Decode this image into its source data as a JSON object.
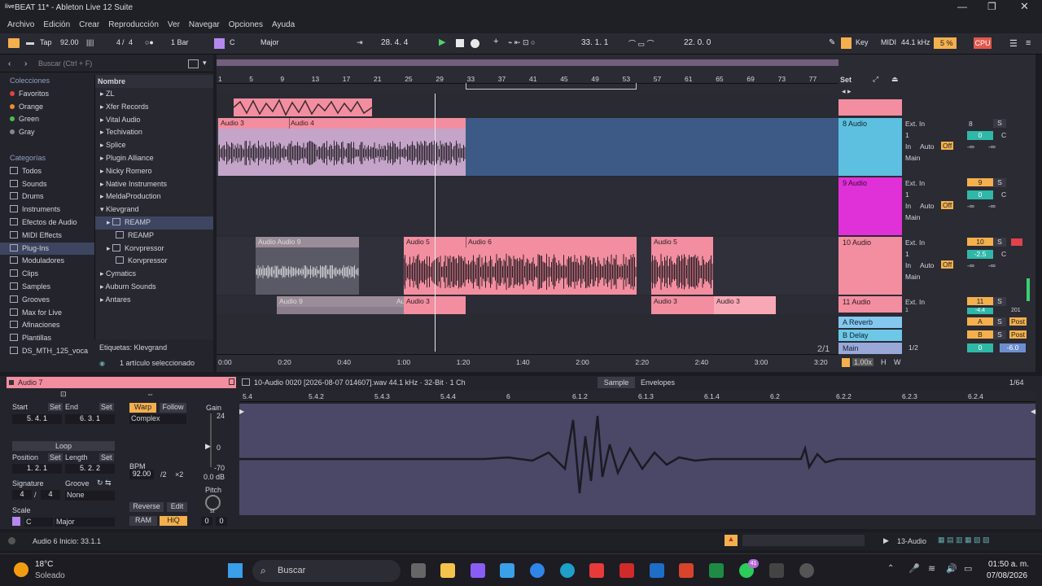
{
  "window": {
    "title": "BEAT 11* - Ableton Live 12 Suite",
    "logo": "live"
  },
  "menu": [
    "Archivo",
    "Edición",
    "Crear",
    "Reproducción",
    "Ver",
    "Navegar",
    "Opciones",
    "Ayuda"
  ],
  "transport": {
    "tap": "Tap",
    "tempo": "92.00",
    "signature_num": "4",
    "signature_den": "4",
    "quant": "1 Bar",
    "key_root": "C",
    "scale": "Major",
    "position": "28.  4.  4",
    "loop_start": "33.  1.  1",
    "loop_length": "22.  0.  0",
    "key": "Key",
    "midi": "MIDI",
    "sample_rate": "44.1 kHz",
    "cpu": "5 %",
    "cpu_label": "CPU"
  },
  "browser": {
    "search_placeholder": "Buscar (Ctrl + F)",
    "collections_title": "Colecciones",
    "collections": [
      {
        "label": "Favoritos",
        "color": "#e0443e"
      },
      {
        "label": "Orange",
        "color": "#f08a2a"
      },
      {
        "label": "Green",
        "color": "#48c048"
      },
      {
        "label": "Gray",
        "color": "#888888"
      }
    ],
    "categories_title": "Categorías",
    "categories": [
      "Todos",
      "Sounds",
      "Drums",
      "Instruments",
      "Efectos de Audio",
      "MIDI Effects",
      "Plug-Ins",
      "Moduladores",
      "Clips",
      "Samples",
      "Grooves",
      "Max for Live",
      "Afinaciones",
      "Plantillas",
      "DS_MTH_125_voca"
    ],
    "selected_category": "Plug-Ins",
    "column_title": "Nombre",
    "items": [
      "ZL",
      "Xfer Records",
      "Vital Audio",
      "Techivation",
      "Splice",
      "Plugin Alliance",
      "Nicky Romero",
      "Native Instruments",
      "MeldaProduction",
      "Klevgrand",
      "REAMP",
      "REAMP",
      "Korvpressor",
      "Korvpressor",
      "Cymatics",
      "Auburn Sounds",
      "Antares"
    ],
    "tags_label": "Etiquetas:",
    "tags_value": "Klevgrand",
    "selection_info": "1 artículo seleccionado"
  },
  "arrangement": {
    "bar_numbers": [
      "1",
      "5",
      "9",
      "13",
      "17",
      "21",
      "25",
      "29",
      "33",
      "37",
      "41",
      "45",
      "49",
      "53",
      "57",
      "61",
      "65",
      "69",
      "73",
      "77"
    ],
    "time_labels": [
      "0:00",
      "0:20",
      "0:40",
      "1:00",
      "1:20",
      "1:40",
      "2:00",
      "2:20",
      "2:40",
      "3:00",
      "3:20"
    ],
    "set_label": "Set",
    "zoom_label": "2/1",
    "clips": {
      "c1": "Audio 3",
      "c2": "Audio 4",
      "c3": "Audio Audio 9",
      "c4": "Audio 5",
      "c5": "Audio 6",
      "c6": "Audio 5",
      "c7": "Audio 9",
      "c8": "Au",
      "c9": "Audio 3",
      "c10": "Audio 3",
      "c11": "Audio 3"
    },
    "tracks": [
      {
        "name": "8 Audio",
        "input": "Ext. In",
        "channel": "1",
        "monitor": "In",
        "auto": "Auto",
        "off": "Off",
        "out": "Main",
        "num": "8",
        "vol": "0",
        "pan": "C",
        "send1": "-∞",
        "send2": "-∞"
      },
      {
        "name": "9 Audio",
        "input": "Ext. In",
        "channel": "1",
        "monitor": "In",
        "auto": "Auto",
        "off": "Off",
        "out": "Main",
        "num": "9",
        "vol": "0",
        "pan": "C",
        "send1": "-∞",
        "send2": "-∞"
      },
      {
        "name": "10 Audio",
        "input": "Ext. In",
        "channel": "1",
        "monitor": "In",
        "auto": "Auto",
        "off": "Off",
        "out": "Main",
        "num": "10",
        "vol": "-2.5",
        "pan": "C",
        "send1": "-∞",
        "send2": "-∞"
      },
      {
        "name": "11 Audio",
        "input": "Ext. In",
        "channel": "1",
        "num": "11",
        "vol": "-4.4",
        "send1": "201"
      }
    ],
    "returns": [
      {
        "name": "A Reverb",
        "letter": "A",
        "post": "Post"
      },
      {
        "name": "B Delay",
        "letter": "B",
        "post": "Post"
      }
    ],
    "main": {
      "name": "Main",
      "ratio": "1/2",
      "vol": "0",
      "db": "-6.0"
    },
    "tempo_scale": "1.00x",
    "h": "H",
    "w": "W",
    "s": "S",
    "c": "C"
  },
  "detail": {
    "clip_name": "Audio 7",
    "file_info": "10-Audio 0020 [2026-08-07 014607].wav  44.1 kHz · 32-Bit · 1 Ch",
    "tabs": [
      "Sample",
      "Envelopes"
    ],
    "grid": "1/64",
    "start_label": "Start",
    "end_label": "End",
    "set_label": "Set",
    "start": "5.   4.   1",
    "end": "6.   3.   1",
    "loop": "Loop",
    "position_label": "Position",
    "length_label": "Length",
    "position": "1.   2.   1",
    "length": "5.   2.   2",
    "signature_label": "Signature",
    "groove_label": "Groove",
    "sig_num": "4",
    "sig_den": "4",
    "groove": "None",
    "scale_label": "Scale",
    "scale_root": "C",
    "scale": "Major",
    "warp": "Warp",
    "follow": "Follow",
    "warp_mode": "Complex",
    "bpm_label": "BPM",
    "bpm": "92.00",
    "half": "/2",
    "double": "×2",
    "reverse": "Reverse",
    "edit": "Edit",
    "ram": "RAM",
    "hiq": "HiQ",
    "gain_label": "Gain",
    "gain_top": "24",
    "gain_mid": "0",
    "gain_bot": "-70",
    "gain_db": "0.0 dB",
    "pitch_label": "Pitch",
    "pitch_st": "st",
    "pitch_a": "0",
    "pitch_b": "0",
    "ruler": [
      "5.4",
      "5.4.2",
      "5.4.3",
      "5.4.4",
      "6",
      "6.1.2",
      "6.1.3",
      "6.1.4",
      "6.2",
      "6.2.2",
      "6.2.3",
      "6.2.4"
    ]
  },
  "status": {
    "text": "Audio 6 Inicio: 33.1.1",
    "track": "13-Audio"
  },
  "taskbar": {
    "temp": "18°C",
    "weather": "Soleado",
    "search": "Buscar",
    "time": "01:50 a. m.",
    "date": "07/08/2026",
    "badge": "41"
  }
}
